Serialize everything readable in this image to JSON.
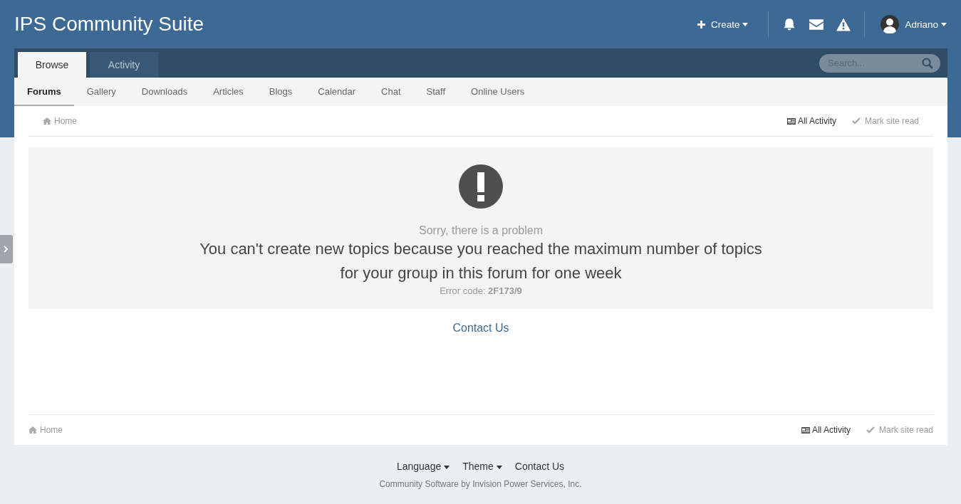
{
  "header": {
    "site_title": "IPS Community Suite",
    "create_label": "Create",
    "user_name": "Adriano"
  },
  "primary_tabs": [
    {
      "label": "Browse",
      "selected": true
    },
    {
      "label": "Activity",
      "selected": false
    }
  ],
  "search": {
    "placeholder": "Search..."
  },
  "secondary_nav": [
    {
      "label": "Forums",
      "selected": true
    },
    {
      "label": "Gallery",
      "selected": false
    },
    {
      "label": "Downloads",
      "selected": false
    },
    {
      "label": "Articles",
      "selected": false
    },
    {
      "label": "Blogs",
      "selected": false
    },
    {
      "label": "Calendar",
      "selected": false
    },
    {
      "label": "Chat",
      "selected": false
    },
    {
      "label": "Staff",
      "selected": false
    },
    {
      "label": "Online Users",
      "selected": false
    }
  ],
  "breadcrumb_top": {
    "home": "Home",
    "all_activity": "All Activity",
    "mark_read": "Mark site read"
  },
  "error": {
    "heading": "Sorry, there is a problem",
    "message": "You can't create new topics because you reached the maximum number of topics for your group in this forum for one week",
    "code": "Error code: **2F173/9**"
  },
  "contact_link": "Contact Us",
  "breadcrumb_bottom": {
    "home": "Home",
    "all_activity": "All Activity",
    "mark_read": "Mark site read"
  },
  "footer": {
    "links": [
      {
        "label": "Language",
        "dropdown": true
      },
      {
        "label": "Theme",
        "dropdown": true
      },
      {
        "label": "Contact Us",
        "dropdown": false
      }
    ],
    "copyright": "Community Software by Invision Power Services, Inc."
  }
}
